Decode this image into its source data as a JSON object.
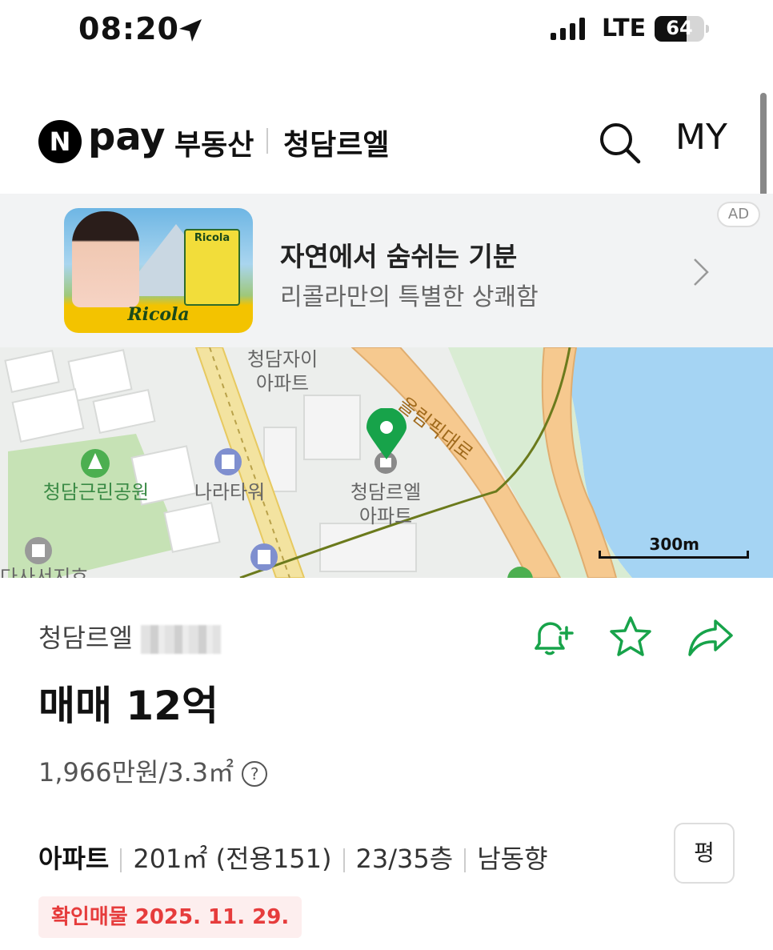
{
  "status_bar": {
    "time": "08:20",
    "network": "LTE",
    "battery": "64",
    "battery_level": 0.64
  },
  "header": {
    "logo_letter": "N",
    "logo_text": "pay",
    "service": "부동산",
    "complex_name": "청담르엘",
    "my_label": "MY"
  },
  "ad": {
    "badge": "AD",
    "title": "자연에서 숨쉬는 기분",
    "subtitle": "리콜라만의 특별한 상쾌함",
    "image_brand": "Ricola",
    "box_text": "Ricola"
  },
  "map": {
    "labels": {
      "apt1_line1": "청담자이",
      "apt1_line2": "아파트",
      "road": "올림픽대로",
      "park": "청담근린공원",
      "tower": "나라타워",
      "apt2_line1": "청담르엘",
      "apt2_line2": "아파트",
      "partial": "다사서지호"
    },
    "scale": "300m",
    "colors": {
      "water": "#a5d4f3",
      "road": "#f6c98f",
      "park": "#c6e2b5",
      "marker": "#17a34a"
    }
  },
  "listing": {
    "complex": "청담르엘",
    "price": "매매 12억",
    "unit_price": "1,966만원/3.3㎡",
    "type": "아파트",
    "area": "201㎡ (전용151)",
    "floor": "23/35층",
    "direction": "남동향",
    "unit_toggle": "평",
    "verified": "확인매물 2025. 11. 29."
  },
  "icons": {
    "accent": "#17a34a"
  }
}
